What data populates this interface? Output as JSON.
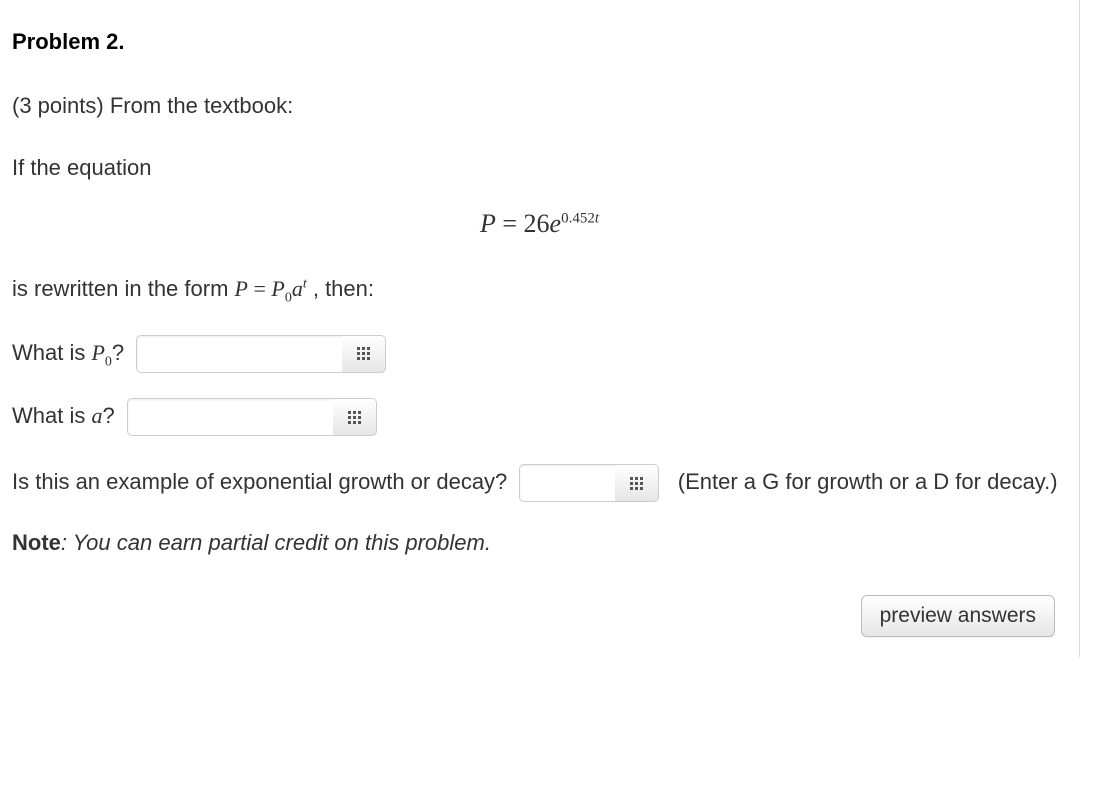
{
  "problem": {
    "title": "Problem 2.",
    "points_line": "(3 points) From the textbook:",
    "intro": "If the equation",
    "equation": {
      "lhs_var": "P",
      "equals": " = ",
      "coef": "26",
      "base": "e",
      "exponent": "0.452",
      "exp_var": "t"
    },
    "rewritten_prefix": "is rewritten in the form ",
    "rewritten_form": {
      "P": "P",
      "eq": " = ",
      "P0": "P",
      "zero": "0",
      "a": "a",
      "t": "t"
    },
    "rewritten_suffix": " , then:",
    "q1_label_prefix": "What is ",
    "q1_var": "P",
    "q1_sub": "0",
    "q1_suffix": "?",
    "q2_label_prefix": "What is ",
    "q2_var": "a",
    "q2_suffix": "?",
    "q3_text": "Is this an example of exponential growth or decay?",
    "q3_hint": "(Enter a G for growth or a D for decay.)",
    "note_label": "Note",
    "note_text": ": You can earn partial credit on this problem.",
    "preview_button": "preview answers",
    "inputs": {
      "p0_value": "",
      "a_value": "",
      "gd_value": ""
    }
  }
}
